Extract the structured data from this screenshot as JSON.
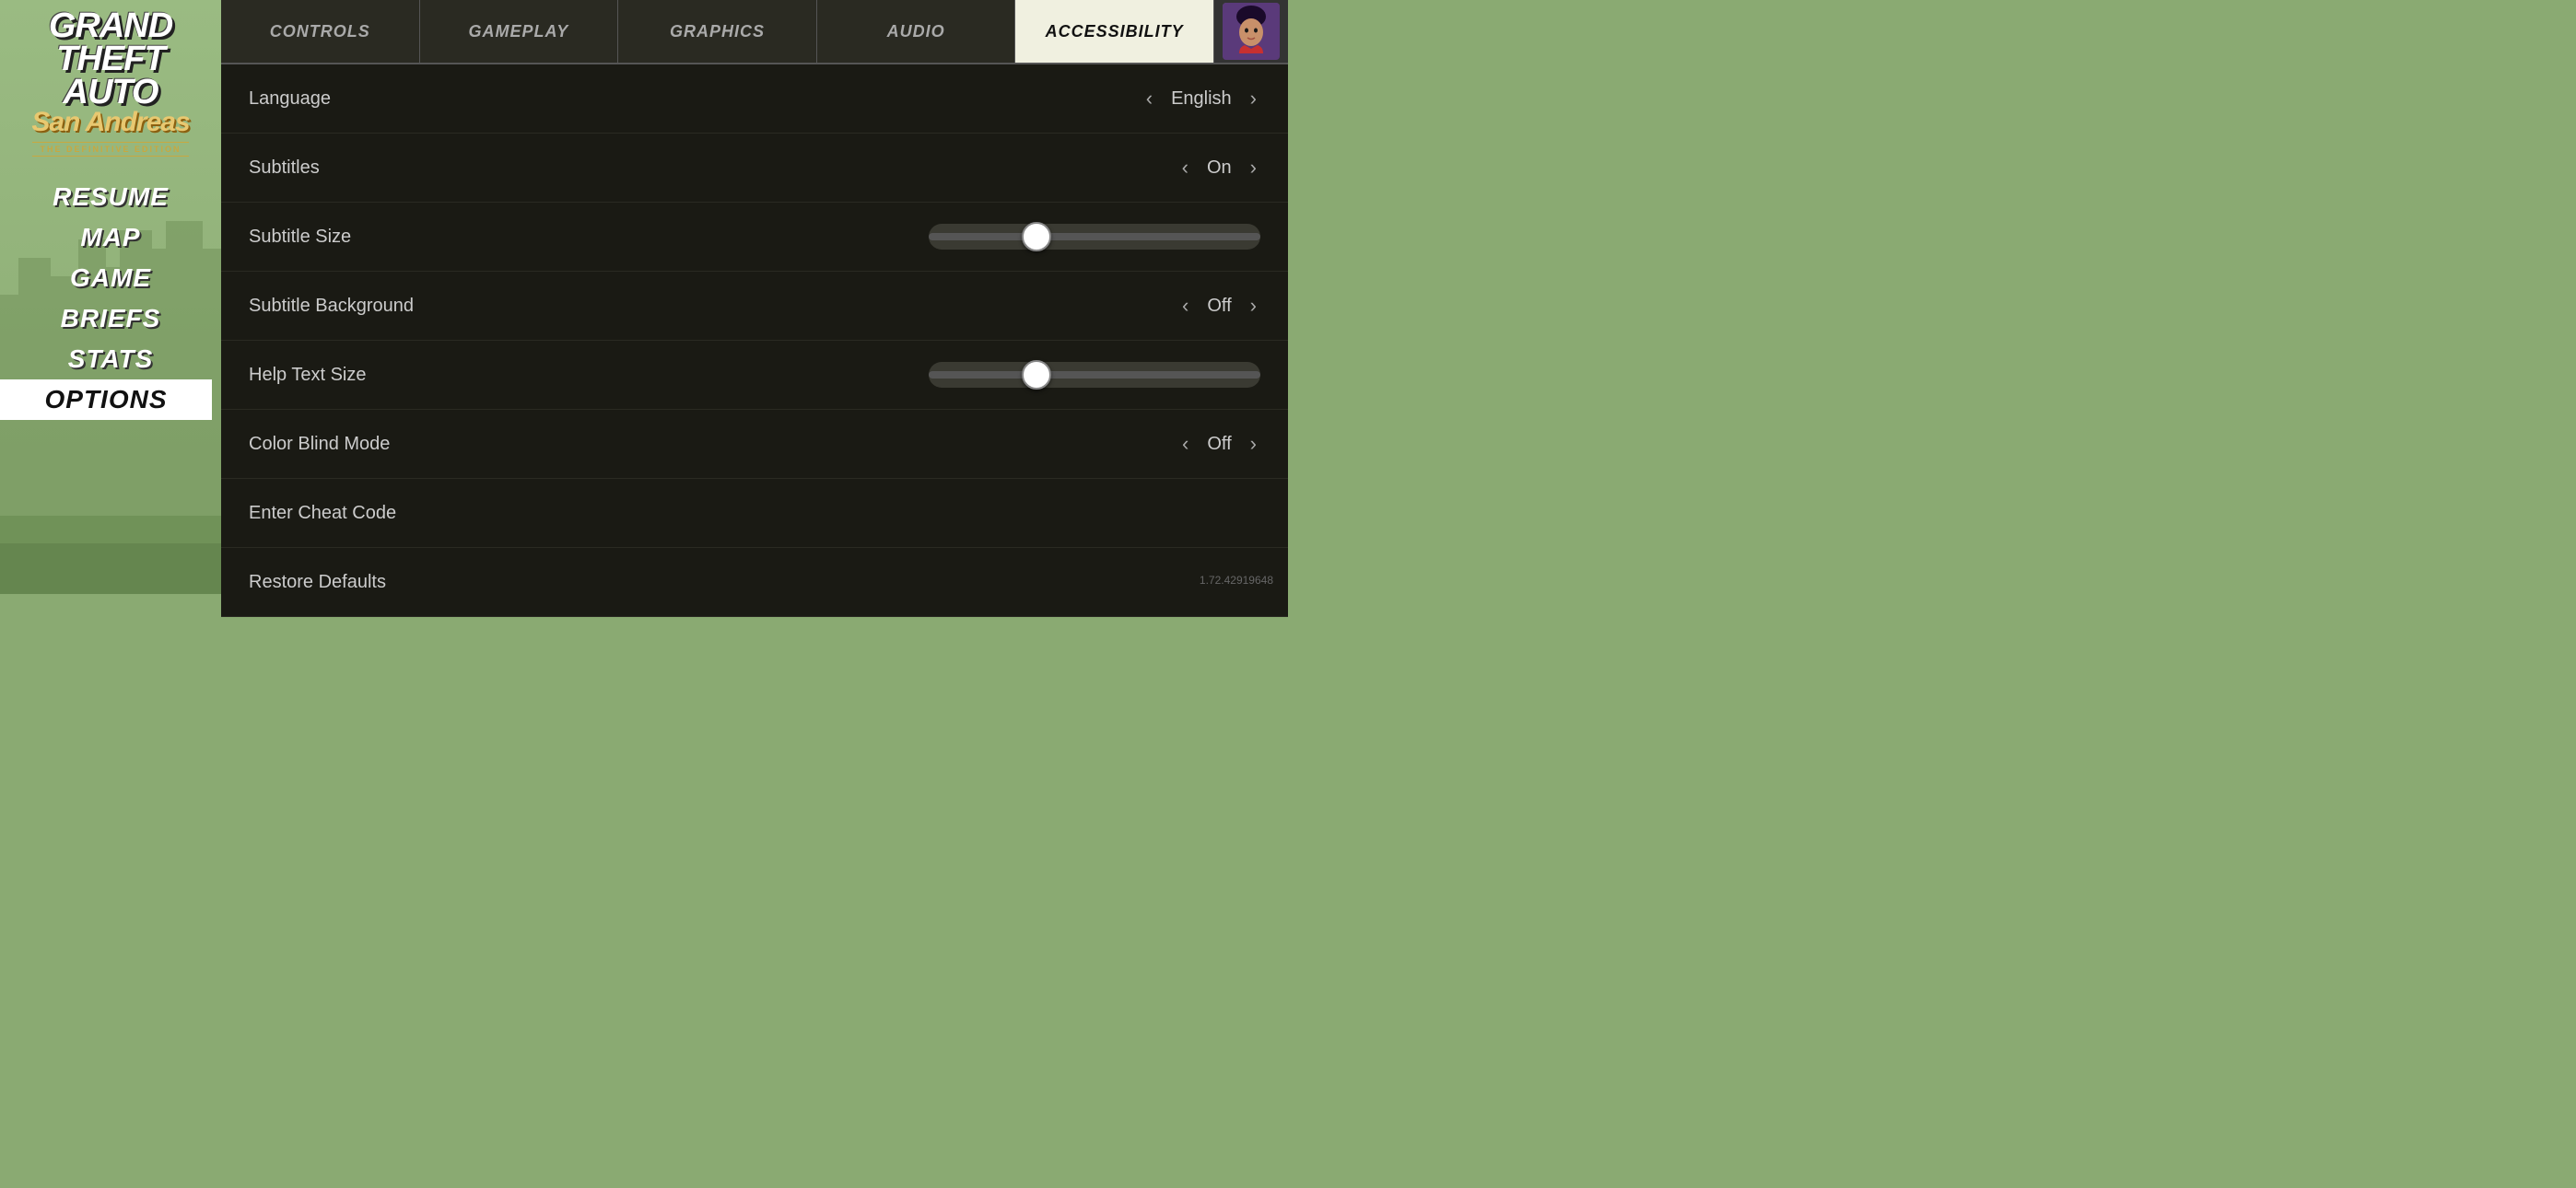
{
  "background": {
    "color": "#8aaa72"
  },
  "logo": {
    "line1": "Grand",
    "line2": "Theft",
    "line3": "Auto",
    "san_andreas": "San Andreas",
    "edition": "The Definitive Edition"
  },
  "nav": {
    "items": [
      {
        "id": "resume",
        "label": "Resume",
        "active": false
      },
      {
        "id": "map",
        "label": "Map",
        "active": false
      },
      {
        "id": "game",
        "label": "Game",
        "active": false
      },
      {
        "id": "briefs",
        "label": "Briefs",
        "active": false
      },
      {
        "id": "stats",
        "label": "Stats",
        "active": false
      },
      {
        "id": "options",
        "label": "Options",
        "active": true
      }
    ]
  },
  "tabs": [
    {
      "id": "controls",
      "label": "Controls",
      "active": false
    },
    {
      "id": "gameplay",
      "label": "Gameplay",
      "active": false
    },
    {
      "id": "graphics",
      "label": "Graphics",
      "active": false
    },
    {
      "id": "audio",
      "label": "Audio",
      "active": false
    },
    {
      "id": "accessibility",
      "label": "Accessibility",
      "active": true
    }
  ],
  "settings": [
    {
      "id": "language",
      "label": "Language",
      "type": "select",
      "value": "English"
    },
    {
      "id": "subtitles",
      "label": "Subtitles",
      "type": "select",
      "value": "On"
    },
    {
      "id": "subtitle-size",
      "label": "Subtitle Size",
      "type": "slider",
      "value": 30
    },
    {
      "id": "subtitle-background",
      "label": "Subtitle Background",
      "type": "select",
      "value": "Off"
    },
    {
      "id": "help-text-size",
      "label": "Help Text Size",
      "type": "slider",
      "value": 30
    },
    {
      "id": "color-blind-mode",
      "label": "Color Blind Mode",
      "type": "select",
      "value": "Off"
    },
    {
      "id": "enter-cheat-code",
      "label": "Enter Cheat Code",
      "type": "action",
      "value": ""
    },
    {
      "id": "restore-defaults",
      "label": "Restore Defaults",
      "type": "action",
      "value": ""
    }
  ],
  "arrows": {
    "left": "‹",
    "right": "›"
  },
  "version": "1.72.42919648"
}
